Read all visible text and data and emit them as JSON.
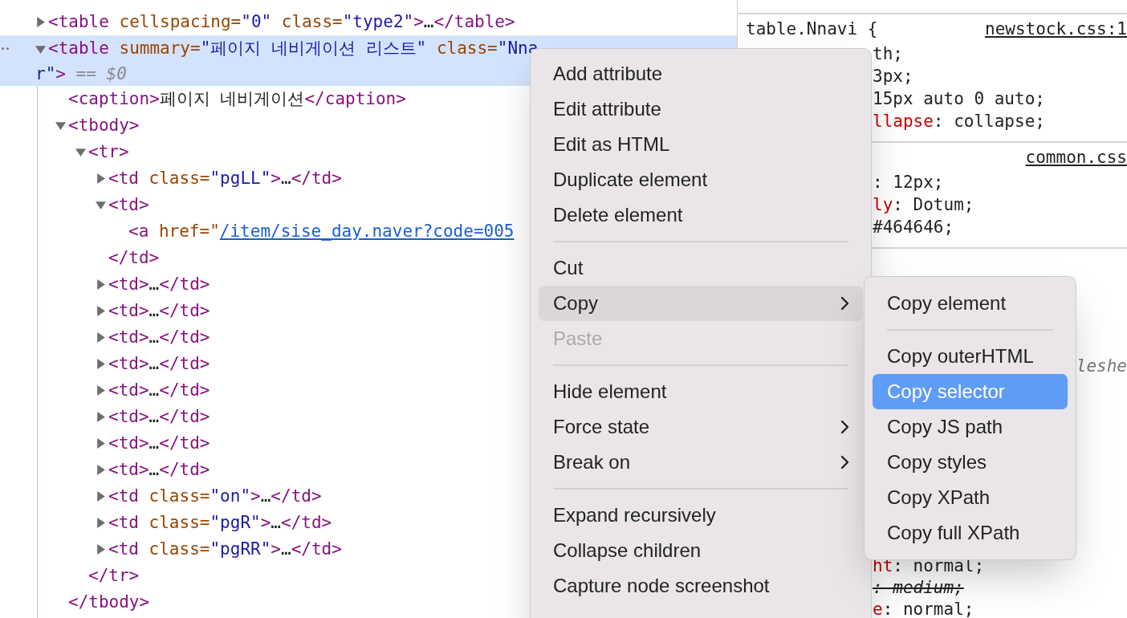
{
  "elements_tree": [
    {
      "parts": [
        {
          "kind": "tag",
          "t": "<table"
        },
        {
          "kind": "attr",
          "t": " cellspacing="
        },
        {
          "kind": "val",
          "t": "\"0\""
        },
        {
          "kind": "attr",
          "t": " class="
        },
        {
          "kind": "val",
          "t": "\"type2\""
        },
        {
          "kind": "tag",
          "t": ">"
        },
        {
          "kind": "text",
          "t": "…"
        },
        {
          "kind": "tag",
          "t": "</table>"
        }
      ],
      "expanded": false,
      "selected": false
    },
    {
      "parts": [
        {
          "kind": "tag",
          "t": "<table"
        },
        {
          "kind": "attr",
          "t": " summary="
        },
        {
          "kind": "val",
          "t": "\"페이지 네비게이션 리스트\""
        },
        {
          "kind": "attr",
          "t": " class="
        },
        {
          "kind": "val",
          "t": "\"Nna"
        }
      ],
      "wrap": [
        {
          "kind": "val",
          "t": "r\""
        },
        {
          "kind": "tag",
          "t": ">"
        },
        {
          "kind": "hint",
          "t": " == $0"
        }
      ],
      "expanded": true,
      "selected": true,
      "children": [
        {
          "parts": [
            {
              "kind": "tag",
              "t": "<caption>"
            },
            {
              "kind": "text",
              "t": "페이지 네비게이션"
            },
            {
              "kind": "tag",
              "t": "</caption>"
            }
          ],
          "selected": false
        },
        {
          "parts": [
            {
              "kind": "tag",
              "t": "<tbody>"
            }
          ],
          "expanded": true,
          "selected": false,
          "close": "</tbody>",
          "children": [
            {
              "parts": [
                {
                  "kind": "tag",
                  "t": "<tr>"
                }
              ],
              "expanded": true,
              "selected": false,
              "close": "</tr>",
              "children": [
                {
                  "parts": [
                    {
                      "kind": "tag",
                      "t": "<td"
                    },
                    {
                      "kind": "attr",
                      "t": " class="
                    },
                    {
                      "kind": "val",
                      "t": "\"pgLL\""
                    },
                    {
                      "kind": "tag",
                      "t": ">"
                    },
                    {
                      "kind": "text",
                      "t": "…"
                    },
                    {
                      "kind": "tag",
                      "t": "</td>"
                    }
                  ],
                  "expanded": false,
                  "selected": false
                },
                {
                  "parts": [
                    {
                      "kind": "tag",
                      "t": "<td>"
                    }
                  ],
                  "expanded": true,
                  "selected": false,
                  "close": "</td>",
                  "children": [
                    {
                      "parts": [
                        {
                          "kind": "tag",
                          "t": "<a"
                        },
                        {
                          "kind": "attr",
                          "t": " href=\""
                        },
                        {
                          "kind": "link",
                          "t": "/item/sise_day.naver?code=005"
                        }
                      ],
                      "selected": false
                    }
                  ]
                },
                {
                  "parts": [
                    {
                      "kind": "tag",
                      "t": "<td>"
                    },
                    {
                      "kind": "text",
                      "t": "…"
                    },
                    {
                      "kind": "tag",
                      "t": "</td>"
                    }
                  ],
                  "expanded": false,
                  "selected": false
                },
                {
                  "parts": [
                    {
                      "kind": "tag",
                      "t": "<td>"
                    },
                    {
                      "kind": "text",
                      "t": "…"
                    },
                    {
                      "kind": "tag",
                      "t": "</td>"
                    }
                  ],
                  "expanded": false,
                  "selected": false
                },
                {
                  "parts": [
                    {
                      "kind": "tag",
                      "t": "<td>"
                    },
                    {
                      "kind": "text",
                      "t": "…"
                    },
                    {
                      "kind": "tag",
                      "t": "</td>"
                    }
                  ],
                  "expanded": false,
                  "selected": false
                },
                {
                  "parts": [
                    {
                      "kind": "tag",
                      "t": "<td>"
                    },
                    {
                      "kind": "text",
                      "t": "…"
                    },
                    {
                      "kind": "tag",
                      "t": "</td>"
                    }
                  ],
                  "expanded": false,
                  "selected": false
                },
                {
                  "parts": [
                    {
                      "kind": "tag",
                      "t": "<td>"
                    },
                    {
                      "kind": "text",
                      "t": "…"
                    },
                    {
                      "kind": "tag",
                      "t": "</td>"
                    }
                  ],
                  "expanded": false,
                  "selected": false
                },
                {
                  "parts": [
                    {
                      "kind": "tag",
                      "t": "<td>"
                    },
                    {
                      "kind": "text",
                      "t": "…"
                    },
                    {
                      "kind": "tag",
                      "t": "</td>"
                    }
                  ],
                  "expanded": false,
                  "selected": false
                },
                {
                  "parts": [
                    {
                      "kind": "tag",
                      "t": "<td>"
                    },
                    {
                      "kind": "text",
                      "t": "…"
                    },
                    {
                      "kind": "tag",
                      "t": "</td>"
                    }
                  ],
                  "expanded": false,
                  "selected": false
                },
                {
                  "parts": [
                    {
                      "kind": "tag",
                      "t": "<td>"
                    },
                    {
                      "kind": "text",
                      "t": "…"
                    },
                    {
                      "kind": "tag",
                      "t": "</td>"
                    }
                  ],
                  "expanded": false,
                  "selected": false
                },
                {
                  "parts": [
                    {
                      "kind": "tag",
                      "t": "<td"
                    },
                    {
                      "kind": "attr",
                      "t": " class="
                    },
                    {
                      "kind": "val",
                      "t": "\"on\""
                    },
                    {
                      "kind": "tag",
                      "t": ">"
                    },
                    {
                      "kind": "text",
                      "t": "…"
                    },
                    {
                      "kind": "tag",
                      "t": "</td>"
                    }
                  ],
                  "expanded": false,
                  "selected": false
                },
                {
                  "parts": [
                    {
                      "kind": "tag",
                      "t": "<td"
                    },
                    {
                      "kind": "attr",
                      "t": " class="
                    },
                    {
                      "kind": "val",
                      "t": "\"pgR\""
                    },
                    {
                      "kind": "tag",
                      "t": ">"
                    },
                    {
                      "kind": "text",
                      "t": "…"
                    },
                    {
                      "kind": "tag",
                      "t": "</td>"
                    }
                  ],
                  "expanded": false,
                  "selected": false
                },
                {
                  "parts": [
                    {
                      "kind": "tag",
                      "t": "<td"
                    },
                    {
                      "kind": "attr",
                      "t": " class="
                    },
                    {
                      "kind": "val",
                      "t": "\"pgRR\""
                    },
                    {
                      "kind": "tag",
                      "t": ">"
                    },
                    {
                      "kind": "text",
                      "t": "…"
                    },
                    {
                      "kind": "tag",
                      "t": "</td>"
                    }
                  ],
                  "expanded": false,
                  "selected": false
                }
              ]
            }
          ]
        }
      ]
    }
  ],
  "styles": [
    {
      "selector": "table.Nnavi {",
      "source": "newstock.css:1",
      "lines": [
        [
          {
            "kind": "plain",
            "t": "th;"
          }
        ],
        [
          {
            "kind": "plain",
            "t": "3px;"
          }
        ],
        [
          {
            "kind": "plain",
            "t": "15px auto 0 auto;"
          }
        ],
        [
          {
            "kind": "prop",
            "t": "llapse"
          },
          {
            "kind": "plain",
            "t": ": collapse;"
          }
        ]
      ]
    },
    {
      "source": "common.css",
      "lines": [
        [
          {
            "kind": "plain",
            "t": ": 12px;"
          }
        ],
        [
          {
            "kind": "prop",
            "t": "ly"
          },
          {
            "kind": "plain",
            "t": ": Dotum;"
          }
        ],
        [
          {
            "kind": "plain",
            "t": "#464646;"
          }
        ]
      ]
    },
    {
      "source_fragment": "leshe",
      "lines": [
        [
          {
            "kind": "prop",
            "t": "ht"
          },
          {
            "kind": "plain",
            "t": ": normal;"
          }
        ],
        [
          {
            "kind": "struck",
            "t": ": medium;"
          }
        ],
        [
          {
            "kind": "prop",
            "t": "e"
          },
          {
            "kind": "plain",
            "t": ": normal;"
          }
        ]
      ]
    }
  ],
  "context_menu": {
    "items": [
      {
        "kind": "item",
        "label": "Add attribute",
        "selected": false,
        "disabled": false,
        "submenu": false
      },
      {
        "kind": "item",
        "label": "Edit attribute",
        "selected": false,
        "disabled": false,
        "submenu": false
      },
      {
        "kind": "item",
        "label": "Edit as HTML",
        "selected": false,
        "disabled": false,
        "submenu": false
      },
      {
        "kind": "item",
        "label": "Duplicate element",
        "selected": false,
        "disabled": false,
        "submenu": false
      },
      {
        "kind": "item",
        "label": "Delete element",
        "selected": false,
        "disabled": false,
        "submenu": false
      },
      {
        "kind": "separator"
      },
      {
        "kind": "item",
        "label": "Cut",
        "selected": false,
        "disabled": false,
        "submenu": false
      },
      {
        "kind": "item",
        "label": "Copy",
        "selected": true,
        "disabled": false,
        "submenu": true
      },
      {
        "kind": "item",
        "label": "Paste",
        "selected": false,
        "disabled": true,
        "submenu": false
      },
      {
        "kind": "separator"
      },
      {
        "kind": "item",
        "label": "Hide element",
        "selected": false,
        "disabled": false,
        "submenu": false
      },
      {
        "kind": "item",
        "label": "Force state",
        "selected": false,
        "disabled": false,
        "submenu": true
      },
      {
        "kind": "item",
        "label": "Break on",
        "selected": false,
        "disabled": false,
        "submenu": true
      },
      {
        "kind": "separator"
      },
      {
        "kind": "item",
        "label": "Expand recursively",
        "selected": false,
        "disabled": false,
        "submenu": false
      },
      {
        "kind": "item",
        "label": "Collapse children",
        "selected": false,
        "disabled": false,
        "submenu": false
      },
      {
        "kind": "item",
        "label": "Capture node screenshot",
        "selected": false,
        "disabled": false,
        "submenu": false
      }
    ]
  },
  "copy_submenu": {
    "items": [
      {
        "kind": "item",
        "label": "Copy element",
        "selected": false
      },
      {
        "kind": "separator"
      },
      {
        "kind": "item",
        "label": "Copy outerHTML",
        "selected": false
      },
      {
        "kind": "item",
        "label": "Copy selector",
        "selected": true
      },
      {
        "kind": "item",
        "label": "Copy JS path",
        "selected": false
      },
      {
        "kind": "item",
        "label": "Copy styles",
        "selected": false
      },
      {
        "kind": "item",
        "label": "Copy XPath",
        "selected": false
      },
      {
        "kind": "item",
        "label": "Copy full XPath",
        "selected": false
      }
    ]
  }
}
